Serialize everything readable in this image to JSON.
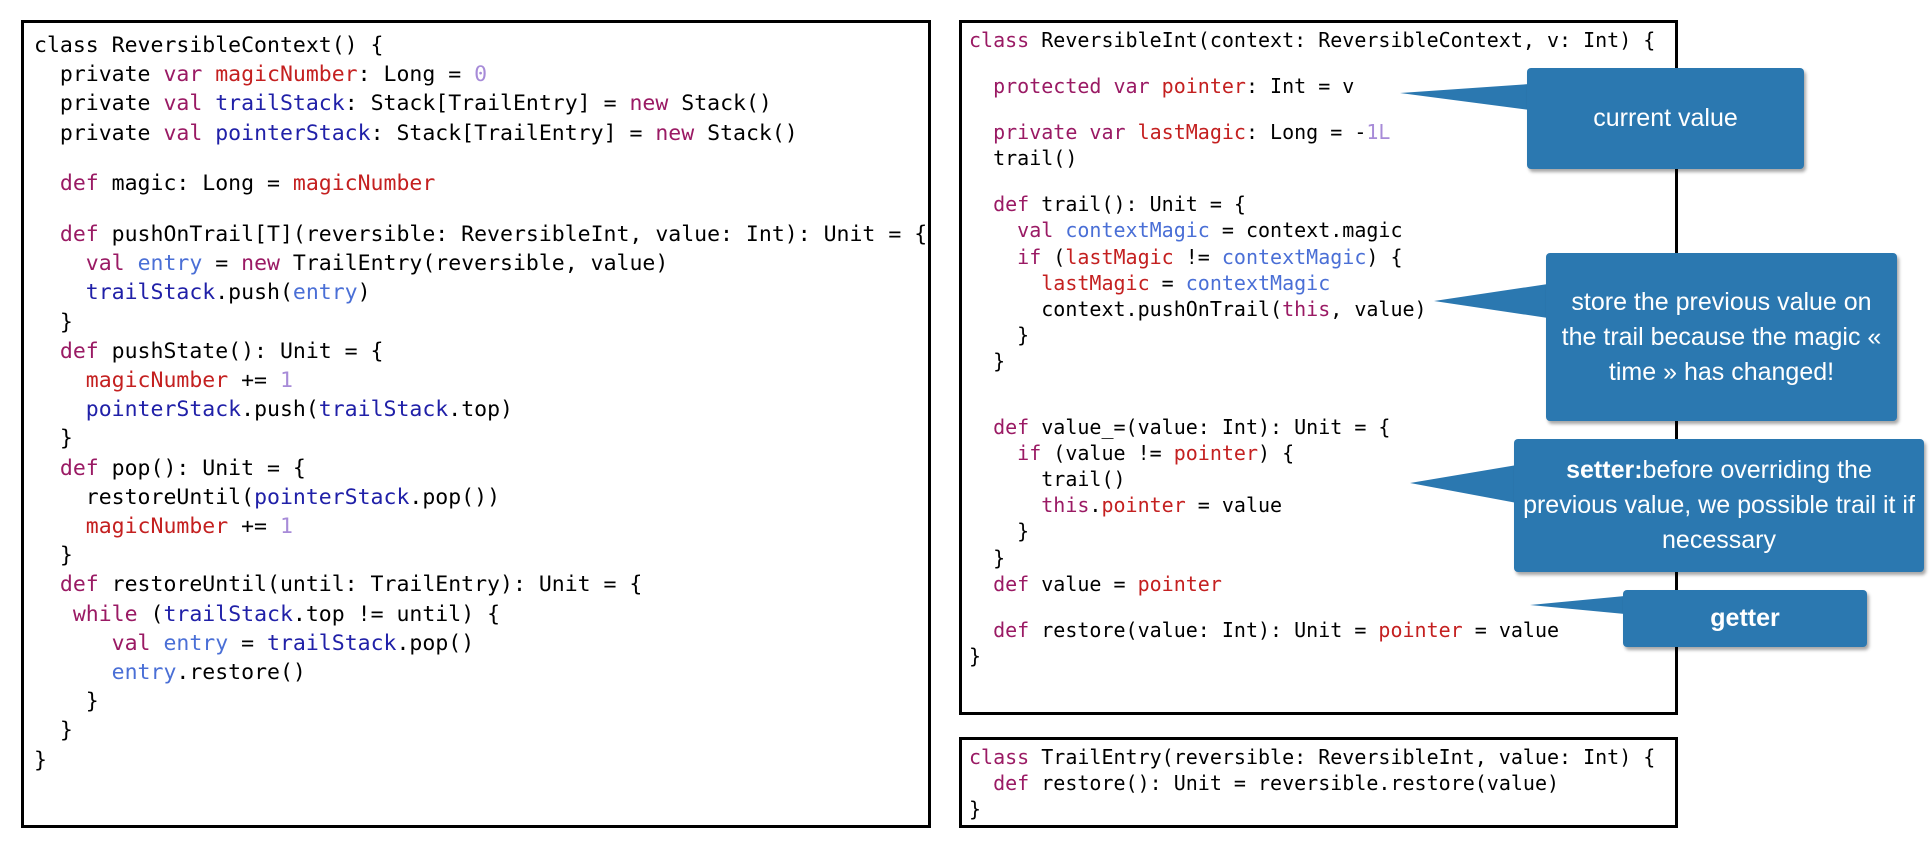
{
  "code_panels": {
    "reversible_context": {
      "lines": [
        [
          [
            "t",
            "class ReversibleContext() {"
          ]
        ],
        [
          [
            "t",
            "  private "
          ],
          [
            "kw",
            "var "
          ],
          [
            "fld",
            "magicNumber"
          ],
          [
            "t",
            ": Long = "
          ],
          [
            "num",
            "0"
          ]
        ],
        [
          [
            "t",
            "  private "
          ],
          [
            "kw",
            "val "
          ],
          [
            "dark",
            "trailStack"
          ],
          [
            "t",
            ": Stack[TrailEntry] = "
          ],
          [
            "kw",
            "new "
          ],
          [
            "t",
            "Stack()"
          ]
        ],
        [
          [
            "t",
            "  private "
          ],
          [
            "kw",
            "val "
          ],
          [
            "dark",
            "pointerStack"
          ],
          [
            "t",
            ": Stack[TrailEntry] = "
          ],
          [
            "kw",
            "new "
          ],
          [
            "t",
            "Stack()"
          ]
        ],
        [
          [
            "t",
            ""
          ]
        ],
        [
          [
            "t",
            "  "
          ],
          [
            "kw",
            "def "
          ],
          [
            "t",
            "magic: Long = "
          ],
          [
            "fld",
            "magicNumber"
          ]
        ],
        [
          [
            "t",
            ""
          ]
        ],
        [
          [
            "t",
            "  "
          ],
          [
            "kw",
            "def "
          ],
          [
            "t",
            "pushOnTrail[T](reversible: ReversibleInt, value: Int): Unit = {"
          ]
        ],
        [
          [
            "t",
            "    "
          ],
          [
            "kw",
            "val "
          ],
          [
            "loc",
            "entry"
          ],
          [
            "t",
            " = "
          ],
          [
            "kw",
            "new "
          ],
          [
            "t",
            "TrailEntry(reversible, value)"
          ]
        ],
        [
          [
            "t",
            "    "
          ],
          [
            "dark",
            "trailStack"
          ],
          [
            "t",
            ".push("
          ],
          [
            "loc",
            "entry"
          ],
          [
            "t",
            ")"
          ]
        ],
        [
          [
            "t",
            "  }"
          ]
        ],
        [
          [
            "t",
            "  "
          ],
          [
            "kw",
            "def "
          ],
          [
            "t",
            "pushState(): Unit = {"
          ]
        ],
        [
          [
            "t",
            "    "
          ],
          [
            "fld",
            "magicNumber"
          ],
          [
            "t",
            " += "
          ],
          [
            "num",
            "1"
          ]
        ],
        [
          [
            "t",
            "    "
          ],
          [
            "dark",
            "pointerStack"
          ],
          [
            "t",
            ".push("
          ],
          [
            "dark",
            "trailStack"
          ],
          [
            "t",
            ".top)"
          ]
        ],
        [
          [
            "t",
            "  }"
          ]
        ],
        [
          [
            "t",
            "  "
          ],
          [
            "kw",
            "def "
          ],
          [
            "t",
            "pop(): Unit = {"
          ]
        ],
        [
          [
            "t",
            "    restoreUntil("
          ],
          [
            "dark",
            "pointerStack"
          ],
          [
            "t",
            ".pop())"
          ]
        ],
        [
          [
            "t",
            "    "
          ],
          [
            "fld",
            "magicNumber"
          ],
          [
            "t",
            " += "
          ],
          [
            "num",
            "1"
          ]
        ],
        [
          [
            "t",
            "  }"
          ]
        ],
        [
          [
            "t",
            "  "
          ],
          [
            "kw",
            "def "
          ],
          [
            "t",
            "restoreUntil(until: TrailEntry): Unit = {"
          ]
        ],
        [
          [
            "t",
            "   "
          ],
          [
            "kw",
            "while "
          ],
          [
            "t",
            "("
          ],
          [
            "dark",
            "trailStack"
          ],
          [
            "t",
            ".top != until) {"
          ]
        ],
        [
          [
            "t",
            "      "
          ],
          [
            "kw",
            "val "
          ],
          [
            "loc",
            "entry"
          ],
          [
            "t",
            " = "
          ],
          [
            "dark",
            "trailStack"
          ],
          [
            "t",
            ".pop()"
          ]
        ],
        [
          [
            "t",
            "      "
          ],
          [
            "loc",
            "entry"
          ],
          [
            "t",
            ".restore()"
          ]
        ],
        [
          [
            "t",
            "    }"
          ]
        ],
        [
          [
            "t",
            "  }"
          ]
        ],
        [
          [
            "t",
            "}"
          ]
        ]
      ]
    },
    "reversible_int": {
      "lines": [
        [
          [
            "kw",
            "class "
          ],
          [
            "t",
            "ReversibleInt(context: ReversibleContext, v: Int) {"
          ]
        ],
        [
          [
            "t",
            ""
          ]
        ],
        [
          [
            "t",
            "  "
          ],
          [
            "kw",
            "protected var "
          ],
          [
            "fld",
            "pointer"
          ],
          [
            "t",
            ": Int = v"
          ]
        ],
        [
          [
            "t",
            ""
          ]
        ],
        [
          [
            "t",
            "  "
          ],
          [
            "kw",
            "private var "
          ],
          [
            "fld",
            "lastMagic"
          ],
          [
            "t",
            ": Long = -"
          ],
          [
            "num",
            "1L"
          ]
        ],
        [
          [
            "t",
            "  trail()"
          ]
        ],
        [
          [
            "t",
            ""
          ]
        ],
        [
          [
            "t",
            "  "
          ],
          [
            "kw",
            "def "
          ],
          [
            "t",
            "trail(): Unit = {"
          ]
        ],
        [
          [
            "t",
            "    "
          ],
          [
            "kw",
            "val "
          ],
          [
            "loc",
            "contextMagic"
          ],
          [
            "t",
            " = context.magic"
          ]
        ],
        [
          [
            "t",
            "    "
          ],
          [
            "kw",
            "if "
          ],
          [
            "t",
            "("
          ],
          [
            "fld",
            "lastMagic"
          ],
          [
            "t",
            " != "
          ],
          [
            "loc",
            "contextMagic"
          ],
          [
            "t",
            ") {"
          ]
        ],
        [
          [
            "t",
            "      "
          ],
          [
            "fld",
            "lastMagic"
          ],
          [
            "t",
            " = "
          ],
          [
            "loc",
            "contextMagic"
          ]
        ],
        [
          [
            "t",
            "      context.pushOnTrail("
          ],
          [
            "kw",
            "this"
          ],
          [
            "t",
            ", value)"
          ]
        ],
        [
          [
            "t",
            "    }"
          ]
        ],
        [
          [
            "t",
            "  }"
          ]
        ],
        [
          [
            "t",
            ""
          ]
        ],
        [
          [
            "t",
            ""
          ]
        ],
        [
          [
            "t",
            "  "
          ],
          [
            "kw",
            "def "
          ],
          [
            "t",
            "value_=(value: Int): Unit = {"
          ]
        ],
        [
          [
            "t",
            "    "
          ],
          [
            "kw",
            "if "
          ],
          [
            "t",
            "(value != "
          ],
          [
            "fld",
            "pointer"
          ],
          [
            "t",
            ") {"
          ]
        ],
        [
          [
            "t",
            "      trail()"
          ]
        ],
        [
          [
            "t",
            "      "
          ],
          [
            "kw",
            "this"
          ],
          [
            "t",
            "."
          ],
          [
            "fld",
            "pointer"
          ],
          [
            "t",
            " = value"
          ]
        ],
        [
          [
            "t",
            "    }"
          ]
        ],
        [
          [
            "t",
            "  }"
          ]
        ],
        [
          [
            "t",
            "  "
          ],
          [
            "kw",
            "def "
          ],
          [
            "t",
            "value = "
          ],
          [
            "fld",
            "pointer"
          ]
        ],
        [
          [
            "t",
            ""
          ]
        ],
        [
          [
            "t",
            "  "
          ],
          [
            "kw",
            "def "
          ],
          [
            "t",
            "restore(value: Int): Unit = "
          ],
          [
            "fld",
            "pointer"
          ],
          [
            "t",
            " = value"
          ]
        ],
        [
          [
            "t",
            "}"
          ]
        ]
      ]
    },
    "trail_entry": {
      "lines": [
        [
          [
            "kw",
            "class "
          ],
          [
            "t",
            "TrailEntry(reversible: ReversibleInt, value: Int) {"
          ]
        ],
        [
          [
            "t",
            "  "
          ],
          [
            "kw",
            "def "
          ],
          [
            "t",
            "restore(): Unit = reversible.restore(value)"
          ]
        ],
        [
          [
            "t",
            "}"
          ]
        ]
      ]
    }
  },
  "callouts": {
    "current_value": "current value",
    "store_previous": "store the previous value on the trail because the magic « time » has changed!",
    "setter_bold": "setter:",
    "setter_rest": "before overriding the previous value, we possible trail it if necessary",
    "getter": "getter"
  },
  "colors": {
    "keyword": "#9a1a64",
    "field": "#c42020",
    "local_variable": "#4a6fd6",
    "stack_field": "#2020a8",
    "number": "#a78bd8",
    "callout_fill": "#2b78b0"
  }
}
